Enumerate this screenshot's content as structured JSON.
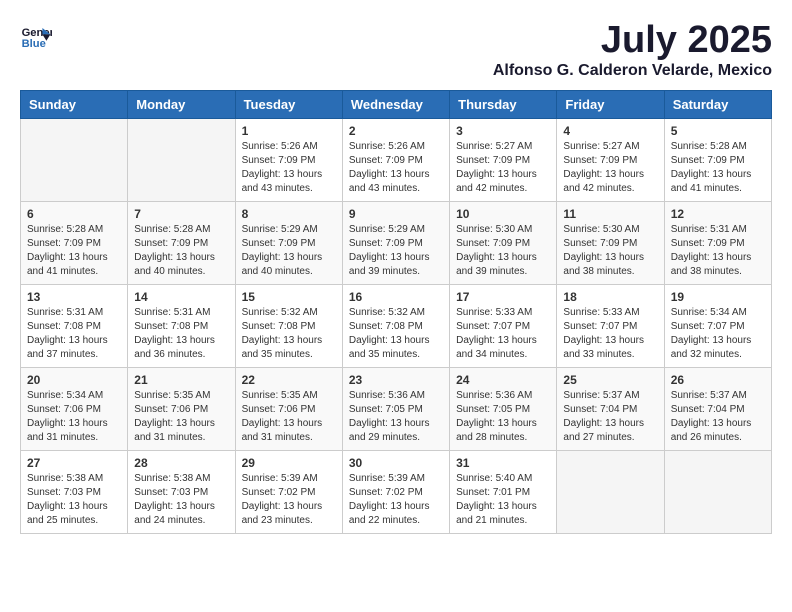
{
  "logo": {
    "line1": "General",
    "line2": "Blue"
  },
  "title": "July 2025",
  "location": "Alfonso G. Calderon Velarde, Mexico",
  "days_of_week": [
    "Sunday",
    "Monday",
    "Tuesday",
    "Wednesday",
    "Thursday",
    "Friday",
    "Saturday"
  ],
  "weeks": [
    [
      {
        "day": "",
        "info": ""
      },
      {
        "day": "",
        "info": ""
      },
      {
        "day": "1",
        "info": "Sunrise: 5:26 AM\nSunset: 7:09 PM\nDaylight: 13 hours and 43 minutes."
      },
      {
        "day": "2",
        "info": "Sunrise: 5:26 AM\nSunset: 7:09 PM\nDaylight: 13 hours and 43 minutes."
      },
      {
        "day": "3",
        "info": "Sunrise: 5:27 AM\nSunset: 7:09 PM\nDaylight: 13 hours and 42 minutes."
      },
      {
        "day": "4",
        "info": "Sunrise: 5:27 AM\nSunset: 7:09 PM\nDaylight: 13 hours and 42 minutes."
      },
      {
        "day": "5",
        "info": "Sunrise: 5:28 AM\nSunset: 7:09 PM\nDaylight: 13 hours and 41 minutes."
      }
    ],
    [
      {
        "day": "6",
        "info": "Sunrise: 5:28 AM\nSunset: 7:09 PM\nDaylight: 13 hours and 41 minutes."
      },
      {
        "day": "7",
        "info": "Sunrise: 5:28 AM\nSunset: 7:09 PM\nDaylight: 13 hours and 40 minutes."
      },
      {
        "day": "8",
        "info": "Sunrise: 5:29 AM\nSunset: 7:09 PM\nDaylight: 13 hours and 40 minutes."
      },
      {
        "day": "9",
        "info": "Sunrise: 5:29 AM\nSunset: 7:09 PM\nDaylight: 13 hours and 39 minutes."
      },
      {
        "day": "10",
        "info": "Sunrise: 5:30 AM\nSunset: 7:09 PM\nDaylight: 13 hours and 39 minutes."
      },
      {
        "day": "11",
        "info": "Sunrise: 5:30 AM\nSunset: 7:09 PM\nDaylight: 13 hours and 38 minutes."
      },
      {
        "day": "12",
        "info": "Sunrise: 5:31 AM\nSunset: 7:09 PM\nDaylight: 13 hours and 38 minutes."
      }
    ],
    [
      {
        "day": "13",
        "info": "Sunrise: 5:31 AM\nSunset: 7:08 PM\nDaylight: 13 hours and 37 minutes."
      },
      {
        "day": "14",
        "info": "Sunrise: 5:31 AM\nSunset: 7:08 PM\nDaylight: 13 hours and 36 minutes."
      },
      {
        "day": "15",
        "info": "Sunrise: 5:32 AM\nSunset: 7:08 PM\nDaylight: 13 hours and 35 minutes."
      },
      {
        "day": "16",
        "info": "Sunrise: 5:32 AM\nSunset: 7:08 PM\nDaylight: 13 hours and 35 minutes."
      },
      {
        "day": "17",
        "info": "Sunrise: 5:33 AM\nSunset: 7:07 PM\nDaylight: 13 hours and 34 minutes."
      },
      {
        "day": "18",
        "info": "Sunrise: 5:33 AM\nSunset: 7:07 PM\nDaylight: 13 hours and 33 minutes."
      },
      {
        "day": "19",
        "info": "Sunrise: 5:34 AM\nSunset: 7:07 PM\nDaylight: 13 hours and 32 minutes."
      }
    ],
    [
      {
        "day": "20",
        "info": "Sunrise: 5:34 AM\nSunset: 7:06 PM\nDaylight: 13 hours and 31 minutes."
      },
      {
        "day": "21",
        "info": "Sunrise: 5:35 AM\nSunset: 7:06 PM\nDaylight: 13 hours and 31 minutes."
      },
      {
        "day": "22",
        "info": "Sunrise: 5:35 AM\nSunset: 7:06 PM\nDaylight: 13 hours and 31 minutes."
      },
      {
        "day": "23",
        "info": "Sunrise: 5:36 AM\nSunset: 7:05 PM\nDaylight: 13 hours and 29 minutes."
      },
      {
        "day": "24",
        "info": "Sunrise: 5:36 AM\nSunset: 7:05 PM\nDaylight: 13 hours and 28 minutes."
      },
      {
        "day": "25",
        "info": "Sunrise: 5:37 AM\nSunset: 7:04 PM\nDaylight: 13 hours and 27 minutes."
      },
      {
        "day": "26",
        "info": "Sunrise: 5:37 AM\nSunset: 7:04 PM\nDaylight: 13 hours and 26 minutes."
      }
    ],
    [
      {
        "day": "27",
        "info": "Sunrise: 5:38 AM\nSunset: 7:03 PM\nDaylight: 13 hours and 25 minutes."
      },
      {
        "day": "28",
        "info": "Sunrise: 5:38 AM\nSunset: 7:03 PM\nDaylight: 13 hours and 24 minutes."
      },
      {
        "day": "29",
        "info": "Sunrise: 5:39 AM\nSunset: 7:02 PM\nDaylight: 13 hours and 23 minutes."
      },
      {
        "day": "30",
        "info": "Sunrise: 5:39 AM\nSunset: 7:02 PM\nDaylight: 13 hours and 22 minutes."
      },
      {
        "day": "31",
        "info": "Sunrise: 5:40 AM\nSunset: 7:01 PM\nDaylight: 13 hours and 21 minutes."
      },
      {
        "day": "",
        "info": ""
      },
      {
        "day": "",
        "info": ""
      }
    ]
  ]
}
